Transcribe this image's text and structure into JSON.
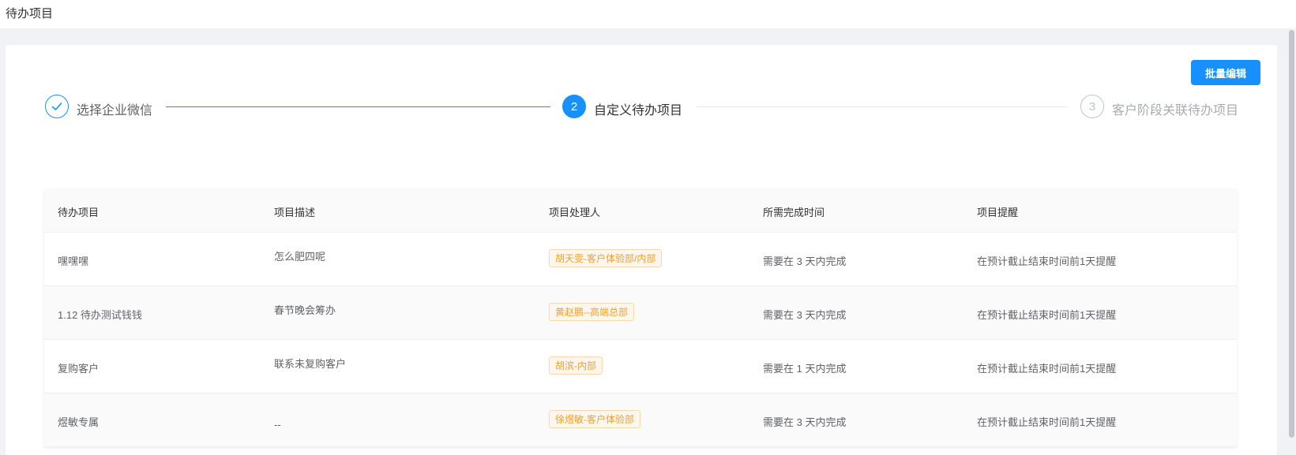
{
  "header": {
    "title": "待办项目"
  },
  "toolbar": {
    "batch_edit_label": "批量编辑"
  },
  "steps": [
    {
      "index": "1",
      "label": "选择企业微信",
      "status": "done"
    },
    {
      "index": "2",
      "label": "自定义待办项目",
      "status": "active"
    },
    {
      "index": "3",
      "label": "客户阶段关联待办项目",
      "status": "wait"
    }
  ],
  "table": {
    "columns": [
      "待办项目",
      "项目描述",
      "项目处理人",
      "所需完成时间",
      "项目提醒"
    ],
    "rows": [
      {
        "item": "嘿嘿嘿",
        "desc": "怎么肥四呢",
        "owner": "胡天雯-客户体验部/内部",
        "deadline": "需要在 3 天内完成",
        "reminder": "在预计截止结束时间前1天提醒"
      },
      {
        "item": "1.12 待办测试钱钱",
        "desc": "春节晚会筹办",
        "owner": "黄赵鹏--高端总部",
        "deadline": "需要在 3 天内完成",
        "reminder": "在预计截止结束时间前1天提醒"
      },
      {
        "item": "复购客户",
        "desc": "联系未复购客户",
        "owner": "胡滨-内部",
        "deadline": "需要在 1 天内完成",
        "reminder": "在预计截止结束时间前1天提醒"
      },
      {
        "item": "煜敏专属",
        "desc": "--",
        "owner": "徐煜敏-客户体验部",
        "deadline": "需要在 3 天内完成",
        "reminder": "在预计截止结束时间前1天提醒"
      }
    ]
  },
  "colors": {
    "primary": "#1890ff",
    "tag_text": "#e6a23c",
    "tag_bg": "#fdf6ec",
    "tag_border": "#f5dab1"
  }
}
